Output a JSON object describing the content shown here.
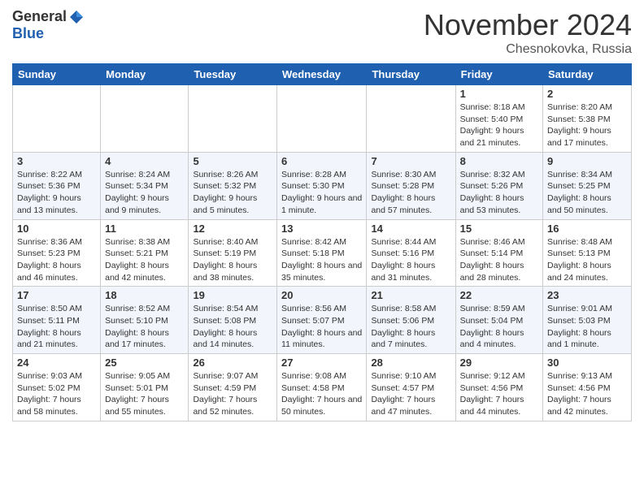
{
  "header": {
    "logo_general": "General",
    "logo_blue": "Blue",
    "month_title": "November 2024",
    "location": "Chesnokovka, Russia"
  },
  "weekdays": [
    "Sunday",
    "Monday",
    "Tuesday",
    "Wednesday",
    "Thursday",
    "Friday",
    "Saturday"
  ],
  "weeks": [
    [
      {
        "day": "",
        "info": ""
      },
      {
        "day": "",
        "info": ""
      },
      {
        "day": "",
        "info": ""
      },
      {
        "day": "",
        "info": ""
      },
      {
        "day": "",
        "info": ""
      },
      {
        "day": "1",
        "info": "Sunrise: 8:18 AM\nSunset: 5:40 PM\nDaylight: 9 hours and 21 minutes."
      },
      {
        "day": "2",
        "info": "Sunrise: 8:20 AM\nSunset: 5:38 PM\nDaylight: 9 hours and 17 minutes."
      }
    ],
    [
      {
        "day": "3",
        "info": "Sunrise: 8:22 AM\nSunset: 5:36 PM\nDaylight: 9 hours and 13 minutes."
      },
      {
        "day": "4",
        "info": "Sunrise: 8:24 AM\nSunset: 5:34 PM\nDaylight: 9 hours and 9 minutes."
      },
      {
        "day": "5",
        "info": "Sunrise: 8:26 AM\nSunset: 5:32 PM\nDaylight: 9 hours and 5 minutes."
      },
      {
        "day": "6",
        "info": "Sunrise: 8:28 AM\nSunset: 5:30 PM\nDaylight: 9 hours and 1 minute."
      },
      {
        "day": "7",
        "info": "Sunrise: 8:30 AM\nSunset: 5:28 PM\nDaylight: 8 hours and 57 minutes."
      },
      {
        "day": "8",
        "info": "Sunrise: 8:32 AM\nSunset: 5:26 PM\nDaylight: 8 hours and 53 minutes."
      },
      {
        "day": "9",
        "info": "Sunrise: 8:34 AM\nSunset: 5:25 PM\nDaylight: 8 hours and 50 minutes."
      }
    ],
    [
      {
        "day": "10",
        "info": "Sunrise: 8:36 AM\nSunset: 5:23 PM\nDaylight: 8 hours and 46 minutes."
      },
      {
        "day": "11",
        "info": "Sunrise: 8:38 AM\nSunset: 5:21 PM\nDaylight: 8 hours and 42 minutes."
      },
      {
        "day": "12",
        "info": "Sunrise: 8:40 AM\nSunset: 5:19 PM\nDaylight: 8 hours and 38 minutes."
      },
      {
        "day": "13",
        "info": "Sunrise: 8:42 AM\nSunset: 5:18 PM\nDaylight: 8 hours and 35 minutes."
      },
      {
        "day": "14",
        "info": "Sunrise: 8:44 AM\nSunset: 5:16 PM\nDaylight: 8 hours and 31 minutes."
      },
      {
        "day": "15",
        "info": "Sunrise: 8:46 AM\nSunset: 5:14 PM\nDaylight: 8 hours and 28 minutes."
      },
      {
        "day": "16",
        "info": "Sunrise: 8:48 AM\nSunset: 5:13 PM\nDaylight: 8 hours and 24 minutes."
      }
    ],
    [
      {
        "day": "17",
        "info": "Sunrise: 8:50 AM\nSunset: 5:11 PM\nDaylight: 8 hours and 21 minutes."
      },
      {
        "day": "18",
        "info": "Sunrise: 8:52 AM\nSunset: 5:10 PM\nDaylight: 8 hours and 17 minutes."
      },
      {
        "day": "19",
        "info": "Sunrise: 8:54 AM\nSunset: 5:08 PM\nDaylight: 8 hours and 14 minutes."
      },
      {
        "day": "20",
        "info": "Sunrise: 8:56 AM\nSunset: 5:07 PM\nDaylight: 8 hours and 11 minutes."
      },
      {
        "day": "21",
        "info": "Sunrise: 8:58 AM\nSunset: 5:06 PM\nDaylight: 8 hours and 7 minutes."
      },
      {
        "day": "22",
        "info": "Sunrise: 8:59 AM\nSunset: 5:04 PM\nDaylight: 8 hours and 4 minutes."
      },
      {
        "day": "23",
        "info": "Sunrise: 9:01 AM\nSunset: 5:03 PM\nDaylight: 8 hours and 1 minute."
      }
    ],
    [
      {
        "day": "24",
        "info": "Sunrise: 9:03 AM\nSunset: 5:02 PM\nDaylight: 7 hours and 58 minutes."
      },
      {
        "day": "25",
        "info": "Sunrise: 9:05 AM\nSunset: 5:01 PM\nDaylight: 7 hours and 55 minutes."
      },
      {
        "day": "26",
        "info": "Sunrise: 9:07 AM\nSunset: 4:59 PM\nDaylight: 7 hours and 52 minutes."
      },
      {
        "day": "27",
        "info": "Sunrise: 9:08 AM\nSunset: 4:58 PM\nDaylight: 7 hours and 50 minutes."
      },
      {
        "day": "28",
        "info": "Sunrise: 9:10 AM\nSunset: 4:57 PM\nDaylight: 7 hours and 47 minutes."
      },
      {
        "day": "29",
        "info": "Sunrise: 9:12 AM\nSunset: 4:56 PM\nDaylight: 7 hours and 44 minutes."
      },
      {
        "day": "30",
        "info": "Sunrise: 9:13 AM\nSunset: 4:56 PM\nDaylight: 7 hours and 42 minutes."
      }
    ]
  ]
}
